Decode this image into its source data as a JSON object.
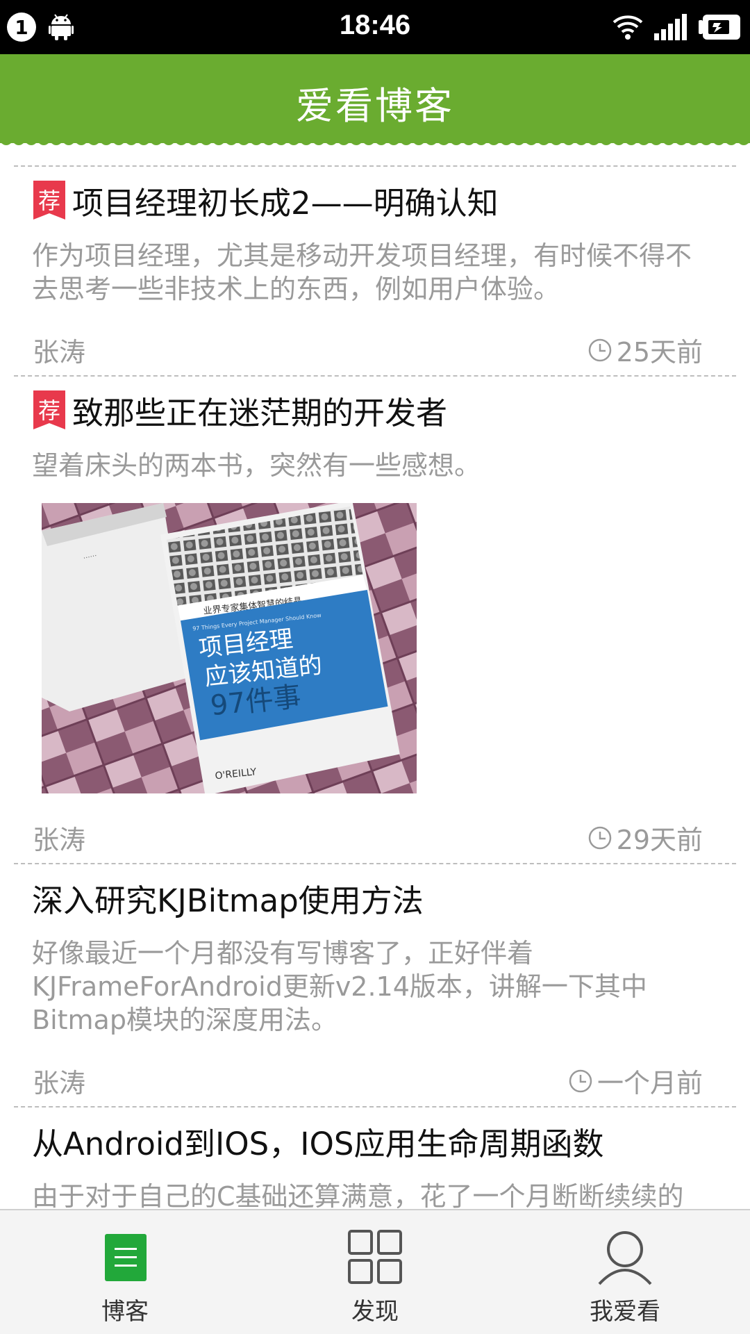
{
  "status_bar": {
    "notification_count": "1",
    "time": "18:46",
    "icons": [
      "android-icon",
      "wifi-icon",
      "signal-icon",
      "battery-icon"
    ]
  },
  "header": {
    "title": "爱看博客"
  },
  "colors": {
    "header_green": "#6aac30",
    "recommend_red": "#e8394c",
    "nav_active_green": "#22a83a"
  },
  "list": {
    "articles": [
      {
        "recommended": true,
        "badge": "荐",
        "title": "项目经理初长成2——明确认知",
        "summary": "作为项目经理，尤其是移动开发项目经理，有时候不得不去思考一些非技术上的东西，例如用户体验。",
        "author": "张涛",
        "time": "25天前"
      },
      {
        "recommended": true,
        "badge": "荐",
        "title": "致那些正在迷茫期的开发者",
        "summary": "望着床头的两本书，突然有一些感想。",
        "image": {
          "top_text": "业界专家集体智慧的结晶",
          "subtitle": "97 Things Every Project Manager Should Know",
          "book_title_1": "项目经理",
          "book_title_2": "应该知道的",
          "book_title_3": "97件事",
          "publisher": "O'REILLY"
        },
        "author": "张涛",
        "time": "29天前"
      },
      {
        "recommended": false,
        "title": "深入研究KJBitmap使用方法",
        "summary": "好像最近一个月都没有写博客了，正好伴着KJFrameForAndroid更新v2.14版本，讲解一下其中Bitmap模块的深度用法。",
        "author": "张涛",
        "time": "一个月前"
      },
      {
        "recommended": false,
        "title": "从Android到IOS，IOS应用生命周期函数",
        "summary": "由于对于自己的C基础还算满意，花了一个月断断续续的把OC看完了，最近在看一些IOS开发的知识，从",
        "author": "",
        "time": ""
      }
    ]
  },
  "bottom_nav": {
    "items": [
      {
        "label": "博客",
        "icon": "blog-list-icon",
        "active": true
      },
      {
        "label": "发现",
        "icon": "grid-icon",
        "active": false
      },
      {
        "label": "我爱看",
        "icon": "user-icon",
        "active": false
      }
    ]
  }
}
